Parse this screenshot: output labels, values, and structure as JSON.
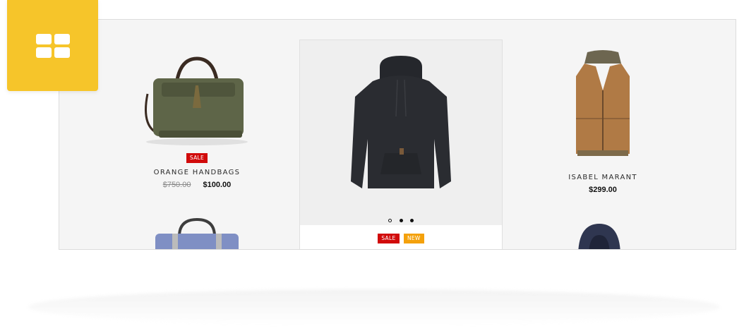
{
  "products": [
    {
      "name": "ORANGE HANDBAGS",
      "old_price": "$750.00",
      "price": "$100.00",
      "tag": "SALE"
    },
    {
      "name": "ISABEL MARANT",
      "price": "$299.00"
    }
  ],
  "featured": {
    "tags": [
      "SALE",
      "NEW"
    ],
    "dots": 3,
    "active_dot": 0
  },
  "icons": {
    "badge": "grid-icon"
  },
  "colors": {
    "badge_bg": "#f6c52a",
    "sale": "#d10a0a",
    "new": "#f4a10b"
  }
}
